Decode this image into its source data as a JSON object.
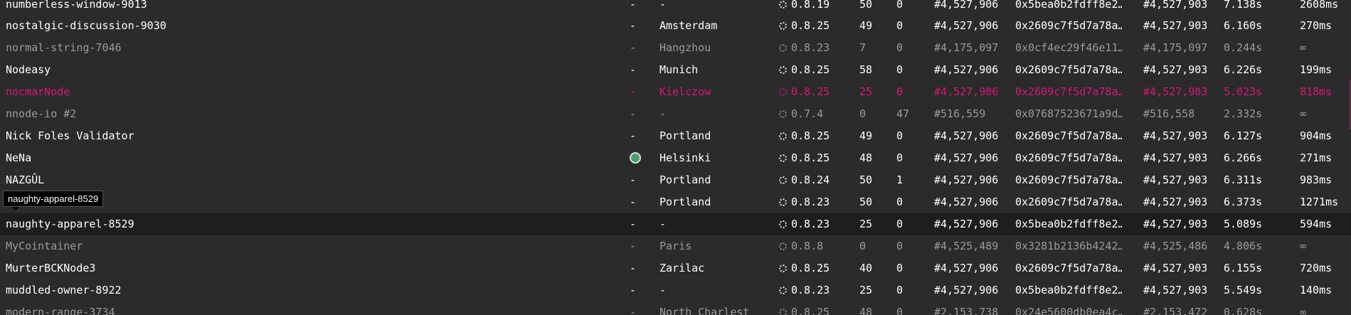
{
  "tooltip": "naughty-apparel-8529",
  "rows": [
    {
      "name": "numberless-window-9013",
      "peers": "-",
      "city": "-",
      "version": "0.8.19",
      "peer_count": "50",
      "pending": "0",
      "block": "#4,527,906",
      "hash": "0x5bea0b2fdff8e2…",
      "finalized": "#4,527,903",
      "block_time": "7.138s",
      "propagation": "2608ms"
    },
    {
      "name": "nostalgic-discussion-9030",
      "peers": "-",
      "city": "Amsterdam",
      "version": "0.8.25",
      "peer_count": "49",
      "pending": "0",
      "block": "#4,527,906",
      "hash": "0x2609c7f5d7a78a…",
      "finalized": "#4,527,903",
      "block_time": "6.160s",
      "propagation": "270ms"
    },
    {
      "name": "normal-string-7046",
      "peers": "-",
      "city": "Hangzhou",
      "version": "0.8.23",
      "peer_count": "7",
      "pending": "0",
      "block": "#4,175,097",
      "hash": "0x0cf4ec29f46e11…",
      "finalized": "#4,175,097",
      "block_time": "0.244s",
      "propagation": "∞"
    },
    {
      "name": "Nodeasy",
      "peers": "-",
      "city": "Munich",
      "version": "0.8.25",
      "peer_count": "58",
      "pending": "0",
      "block": "#4,527,906",
      "hash": "0x2609c7f5d7a78a…",
      "finalized": "#4,527,903",
      "block_time": "6.226s",
      "propagation": "199ms"
    },
    {
      "name": "nocmarNode",
      "peers": "-",
      "city": "Kielczow",
      "version": "0.8.25",
      "peer_count": "25",
      "pending": "0",
      "block": "#4,527,906",
      "hash": "0x2609c7f5d7a78a…",
      "finalized": "#4,527,903",
      "block_time": "5.023s",
      "propagation": "818ms"
    },
    {
      "name": "nnode-io #2",
      "peers": "-",
      "city": "-",
      "version": "0.7.4",
      "peer_count": "0",
      "pending": "47",
      "block": "#516,559",
      "hash": "0x07687523671a9d…",
      "finalized": "#516,558",
      "block_time": "2.332s",
      "propagation": "∞"
    },
    {
      "name": "Nick Foles Validator",
      "peers": "-",
      "city": "Portland",
      "version": "0.8.25",
      "peer_count": "49",
      "pending": "0",
      "block": "#4,527,906",
      "hash": "0x2609c7f5d7a78a…",
      "finalized": "#4,527,903",
      "block_time": "6.127s",
      "propagation": "904ms"
    },
    {
      "name": "NeNa",
      "peers": "",
      "city": "Helsinki",
      "version": "0.8.25",
      "peer_count": "48",
      "pending": "0",
      "block": "#4,527,906",
      "hash": "0x2609c7f5d7a78a…",
      "finalized": "#4,527,903",
      "block_time": "6.266s",
      "propagation": "271ms"
    },
    {
      "name": "NAZGÛL",
      "peers": "-",
      "city": "Portland",
      "version": "0.8.24",
      "peer_count": "50",
      "pending": "1",
      "block": "#4,527,906",
      "hash": "0x2609c7f5d7a78a…",
      "finalized": "#4,527,903",
      "block_time": "6.311s",
      "propagation": "983ms"
    },
    {
      "name": "",
      "peers": "-",
      "city": "Portland",
      "version": "0.8.23",
      "peer_count": "50",
      "pending": "0",
      "block": "#4,527,906",
      "hash": "0x2609c7f5d7a78a…",
      "finalized": "#4,527,903",
      "block_time": "6.373s",
      "propagation": "1271ms"
    },
    {
      "name": "naughty-apparel-8529",
      "peers": "-",
      "city": "-",
      "version": "0.8.23",
      "peer_count": "25",
      "pending": "0",
      "block": "#4,527,906",
      "hash": "0x5bea0b2fdff8e2…",
      "finalized": "#4,527,903",
      "block_time": "5.089s",
      "propagation": "594ms"
    },
    {
      "name": "MyCointainer",
      "peers": "-",
      "city": "Paris",
      "version": "0.8.8",
      "peer_count": "0",
      "pending": "0",
      "block": "#4,525,489",
      "hash": "0x3281b2136b4242…",
      "finalized": "#4,525,486",
      "block_time": "4.806s",
      "propagation": "∞"
    },
    {
      "name": "MurterBCKNode3",
      "peers": "-",
      "city": "Zarilac",
      "version": "0.8.25",
      "peer_count": "40",
      "pending": "0",
      "block": "#4,527,906",
      "hash": "0x2609c7f5d7a78a…",
      "finalized": "#4,527,903",
      "block_time": "6.155s",
      "propagation": "720ms"
    },
    {
      "name": "muddled-owner-8922",
      "peers": "-",
      "city": "-",
      "version": "0.8.23",
      "peer_count": "25",
      "pending": "0",
      "block": "#4,527,906",
      "hash": "0x5bea0b2fdff8e2…",
      "finalized": "#4,527,903",
      "block_time": "5.549s",
      "propagation": "140ms"
    },
    {
      "name": "modern-range-3734",
      "peers": "-",
      "city": "North Charlest",
      "version": "0.8.25",
      "peer_count": "48",
      "pending": "0",
      "block": "#2,153,738",
      "hash": "0x24e5600db0ea4c…",
      "finalized": "#2,153,472",
      "block_time": "0.628s",
      "propagation": "∞"
    }
  ]
}
